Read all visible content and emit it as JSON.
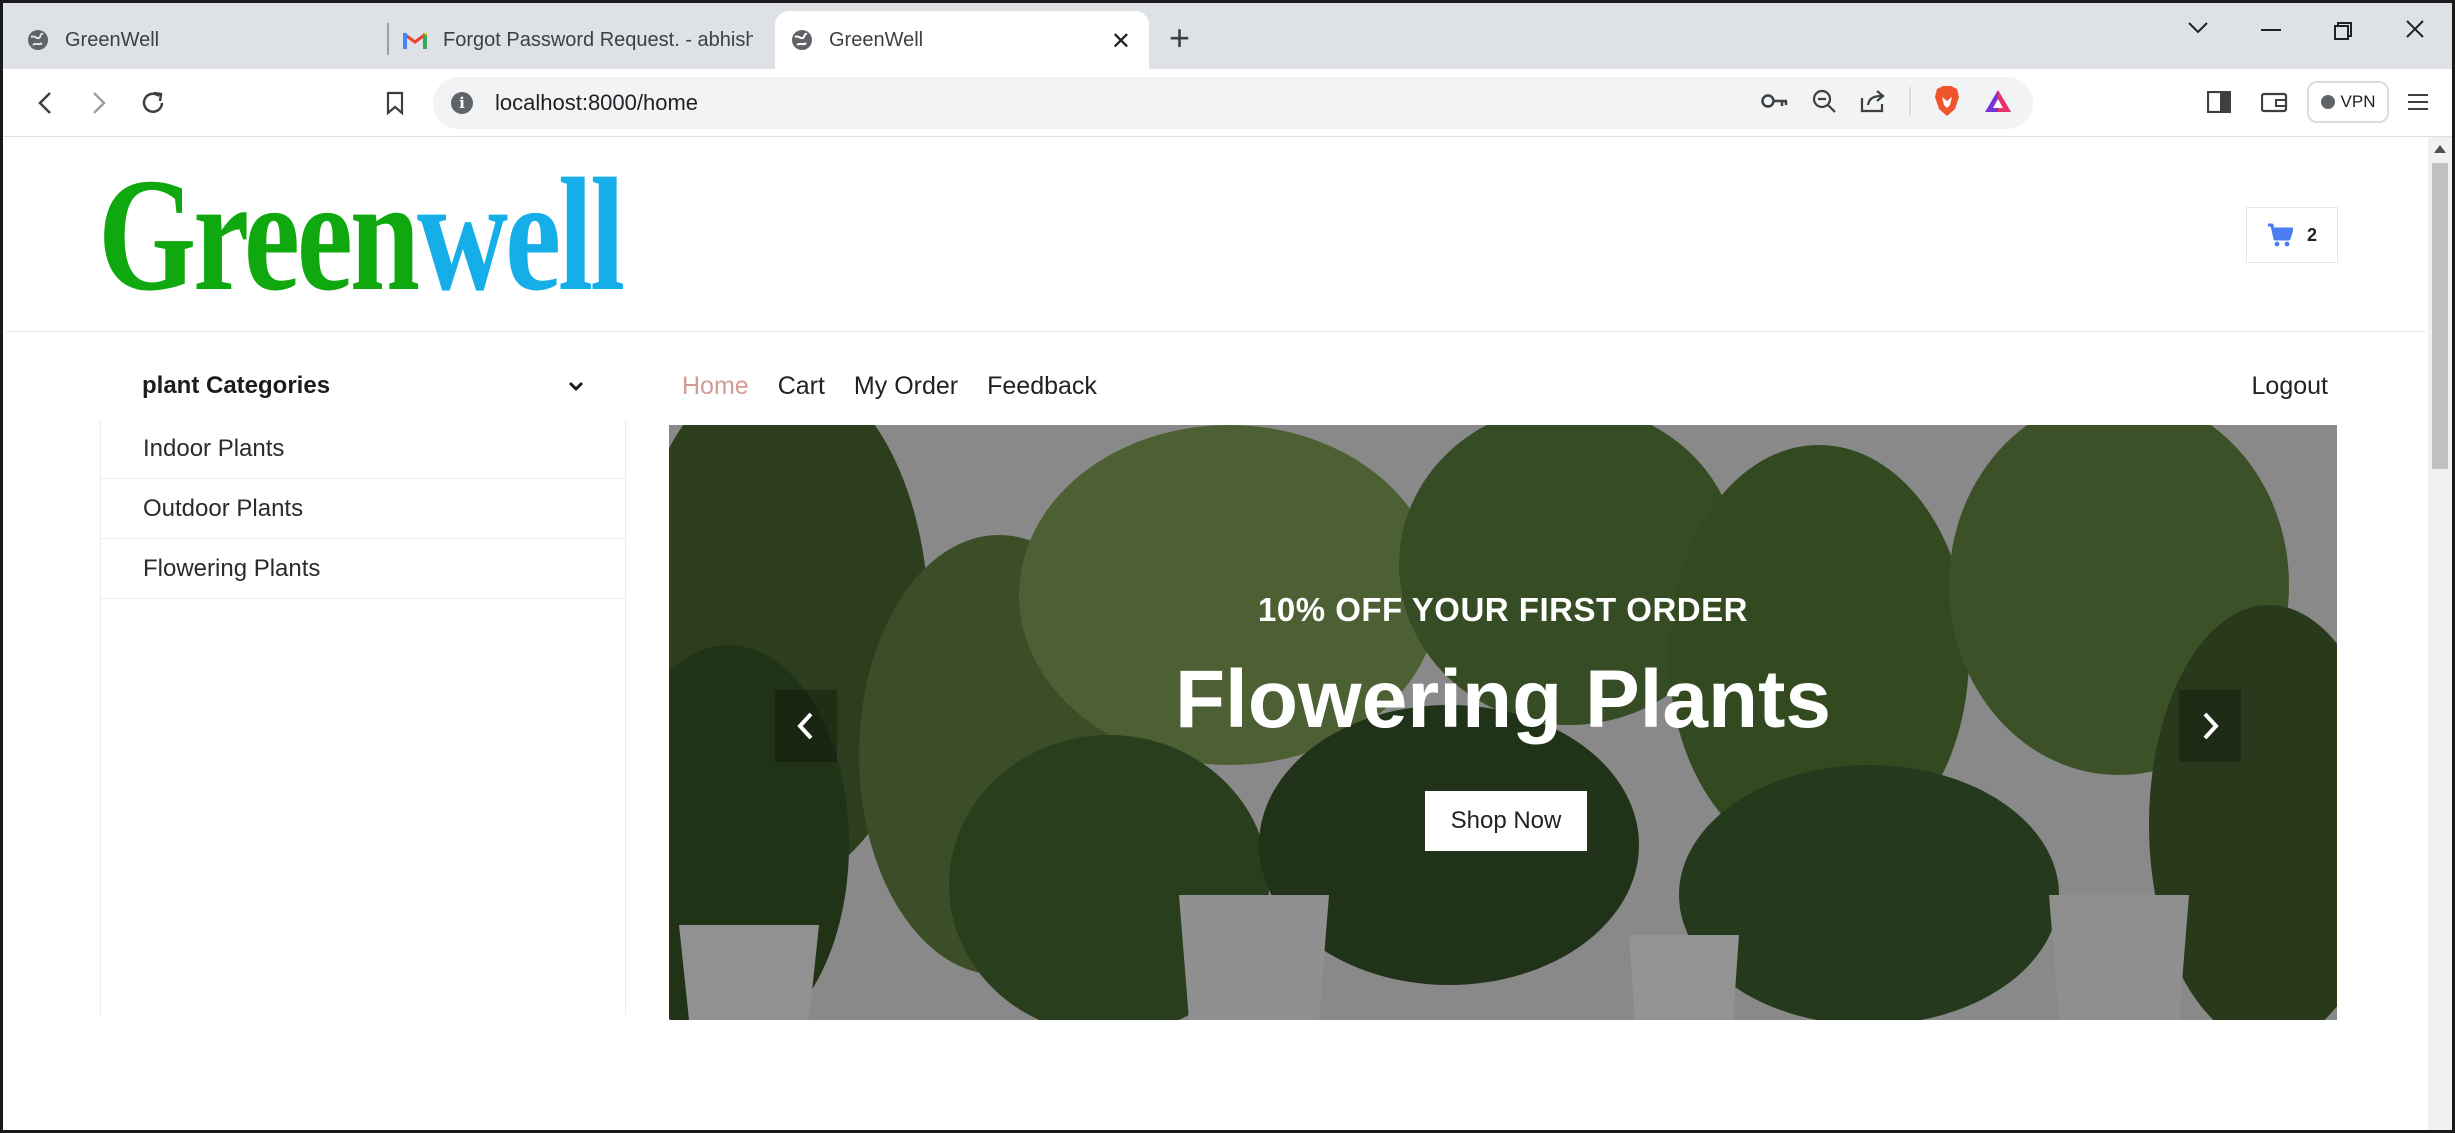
{
  "browser": {
    "tabs": [
      {
        "label": "GreenWell"
      },
      {
        "label": "Forgot Password Request. - abhishek"
      },
      {
        "label": "GreenWell"
      }
    ],
    "url": "localhost:8000/home",
    "vpn_label": "VPN"
  },
  "site": {
    "logo": {
      "part1": "Green",
      "part2": "well",
      "color1": "#0fa80f",
      "color2": "#16aee8"
    },
    "cart_count": "2",
    "categories": {
      "heading": "plant Categories",
      "items": [
        "Indoor Plants",
        "Outdoor Plants",
        "Flowering Plants"
      ]
    },
    "nav": {
      "items": [
        "Home",
        "Cart",
        "My Order",
        "Feedback"
      ],
      "active": "Home",
      "logout": "Logout",
      "active_color": "#d19c97"
    },
    "hero": {
      "subtitle": "10% OFF YOUR FIRST ORDER",
      "title": "Flowering Plants",
      "button": "Shop Now"
    }
  },
  "icons": [
    "globe-icon",
    "gmail-icon",
    "close-icon",
    "plus-icon",
    "back-icon",
    "forward-icon",
    "reload-icon",
    "bookmark-icon",
    "info-icon",
    "key-icon",
    "zoom-out-icon",
    "share-icon",
    "brave-shield-icon",
    "rewards-icon",
    "sidebar-icon",
    "wallet-icon",
    "menu-icon",
    "cart-icon",
    "chevron-down-icon",
    "chevron-left-icon",
    "chevron-right-icon"
  ]
}
